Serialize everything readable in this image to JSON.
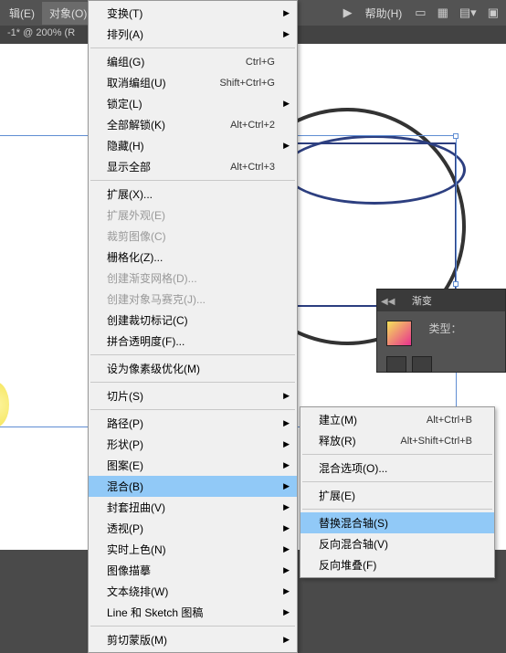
{
  "menubar": {
    "items": [
      "辑(E)",
      "对象(O)"
    ],
    "help": "帮助(H)"
  },
  "tab": "-1* @ 200% (R",
  "mainMenu": [
    {
      "label": "变换(T)",
      "arrow": true
    },
    {
      "label": "排列(A)",
      "arrow": true
    },
    {
      "sep": true
    },
    {
      "label": "编组(G)",
      "shortcut": "Ctrl+G"
    },
    {
      "label": "取消编组(U)",
      "shortcut": "Shift+Ctrl+G"
    },
    {
      "label": "锁定(L)",
      "arrow": true
    },
    {
      "label": "全部解锁(K)",
      "shortcut": "Alt+Ctrl+2"
    },
    {
      "label": "隐藏(H)",
      "arrow": true
    },
    {
      "label": "显示全部",
      "shortcut": "Alt+Ctrl+3"
    },
    {
      "sep": true
    },
    {
      "label": "扩展(X)..."
    },
    {
      "label": "扩展外观(E)",
      "disabled": true
    },
    {
      "label": "裁剪图像(C)",
      "disabled": true
    },
    {
      "label": "栅格化(Z)..."
    },
    {
      "label": "创建渐变网格(D)...",
      "disabled": true
    },
    {
      "label": "创建对象马赛克(J)...",
      "disabled": true
    },
    {
      "label": "创建裁切标记(C)"
    },
    {
      "label": "拼合透明度(F)..."
    },
    {
      "sep": true
    },
    {
      "label": "设为像素级优化(M)"
    },
    {
      "sep": true
    },
    {
      "label": "切片(S)",
      "arrow": true
    },
    {
      "sep": true
    },
    {
      "label": "路径(P)",
      "arrow": true
    },
    {
      "label": "形状(P)",
      "arrow": true
    },
    {
      "label": "图案(E)",
      "arrow": true
    },
    {
      "label": "混合(B)",
      "arrow": true,
      "hl": true
    },
    {
      "label": "封套扭曲(V)",
      "arrow": true
    },
    {
      "label": "透视(P)",
      "arrow": true
    },
    {
      "label": "实时上色(N)",
      "arrow": true
    },
    {
      "label": "图像描摹",
      "arrow": true
    },
    {
      "label": "文本绕排(W)",
      "arrow": true
    },
    {
      "label": "Line 和 Sketch 图稿",
      "arrow": true
    },
    {
      "sep": true
    },
    {
      "label": "剪切蒙版(M)",
      "arrow": true
    }
  ],
  "subMenu": [
    {
      "label": "建立(M)",
      "shortcut": "Alt+Ctrl+B"
    },
    {
      "label": "释放(R)",
      "shortcut": "Alt+Shift+Ctrl+B"
    },
    {
      "sep": true
    },
    {
      "label": "混合选项(O)..."
    },
    {
      "sep": true
    },
    {
      "label": "扩展(E)"
    },
    {
      "sep": true
    },
    {
      "label": "替换混合轴(S)",
      "hl": true
    },
    {
      "label": "反向混合轴(V)"
    },
    {
      "label": "反向堆叠(F)"
    }
  ],
  "panel": {
    "title": "渐变",
    "type_label": "类型："
  }
}
